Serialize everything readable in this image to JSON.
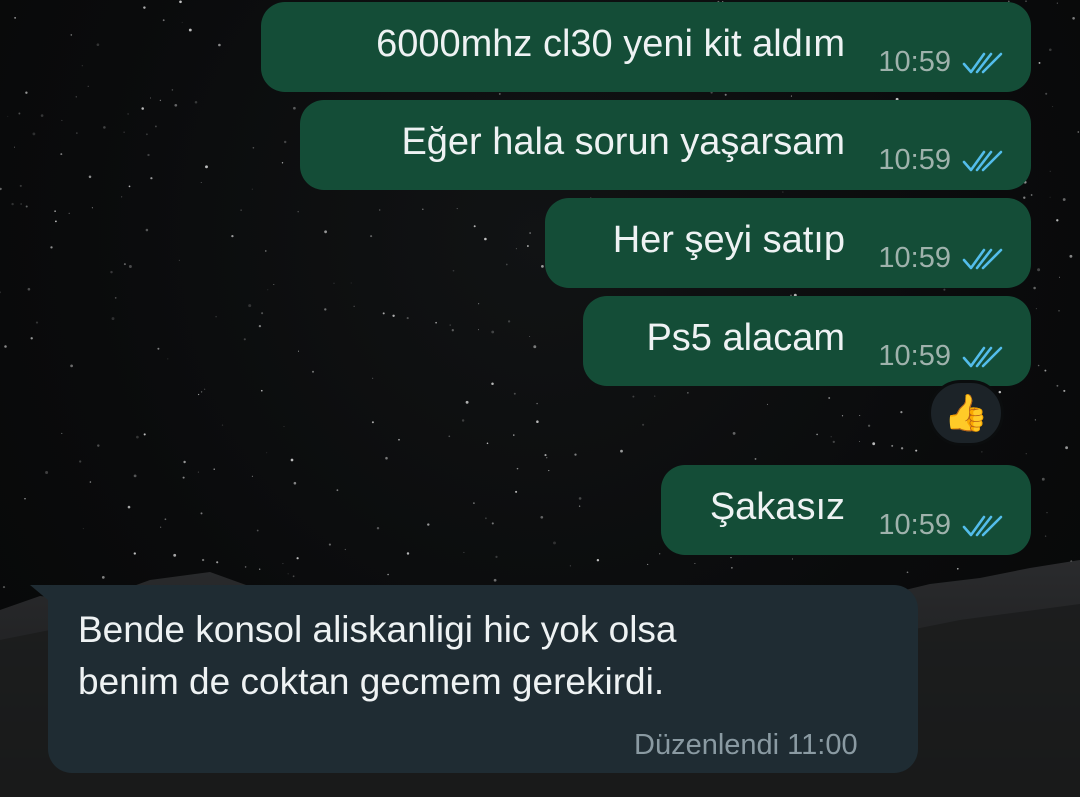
{
  "conversation": {
    "outgoing": [
      {
        "text": "6000mhz cl30 yeni kit aldım",
        "time": "10:59",
        "status": "read"
      },
      {
        "text": "Eğer hala sorun yaşarsam",
        "time": "10:59",
        "status": "read"
      },
      {
        "text": "Her şeyi satıp",
        "time": "10:59",
        "status": "read"
      },
      {
        "text": "Ps5 alacam",
        "time": "10:59",
        "status": "read"
      },
      {
        "text": "Şakasız",
        "time": "10:59",
        "status": "read"
      }
    ],
    "reaction": {
      "emoji": "👍"
    },
    "incoming": {
      "lines": [
        "Bende konsol aliskanligi hic yok olsa",
        "benim de coktan gecmem gerekirdi."
      ],
      "meta": "Düzenlendi 11:00"
    }
  },
  "colors": {
    "outgoing_bubble": "#144d37",
    "incoming_bubble": "#1f2c33",
    "read_tick": "#53bdeb",
    "background": "#0a0b0c"
  },
  "icons": {
    "read_receipt": "double-check-icon"
  }
}
